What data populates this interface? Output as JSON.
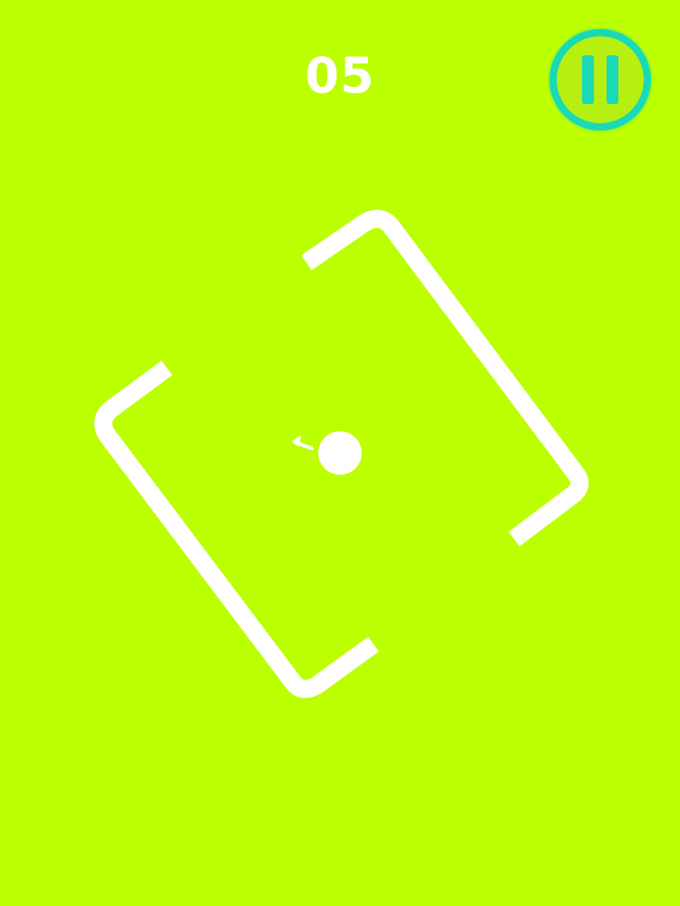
{
  "hud": {
    "score": "05",
    "pause_icon": "pause-icon"
  },
  "colors": {
    "background": "#BBFF00",
    "paddle": "#FFFFFF",
    "ball": "#FFFFFF",
    "pause_ring": "#19D9B6",
    "pause_fill": "#B7F010"
  },
  "game": {
    "ball_direction": "left"
  }
}
